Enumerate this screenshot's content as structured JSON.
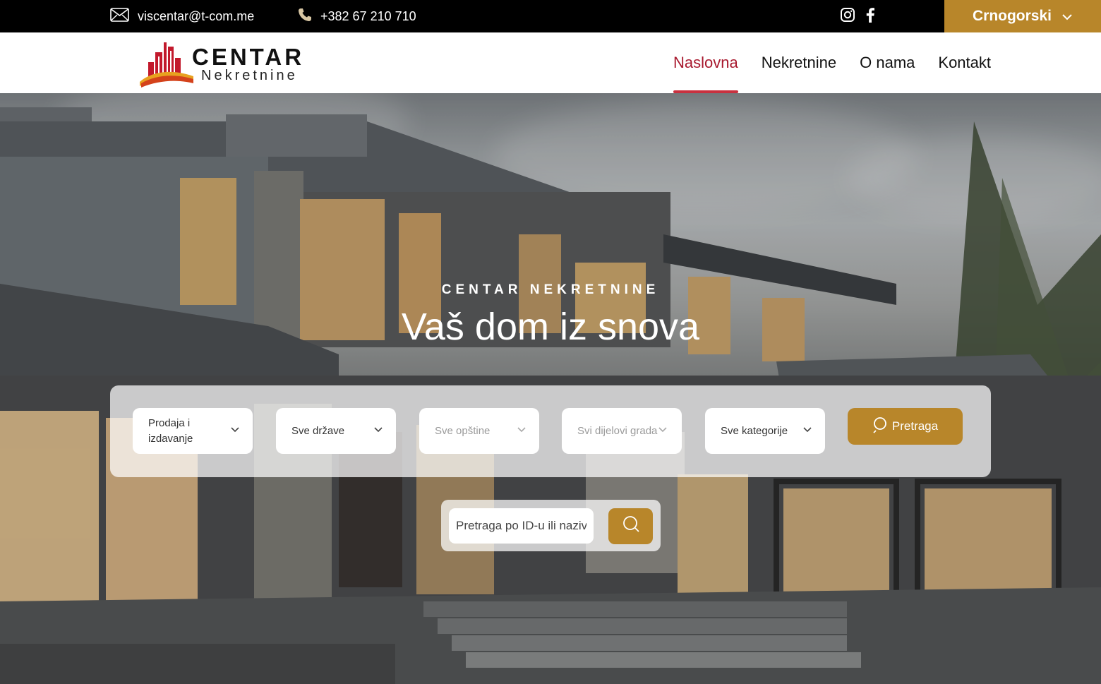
{
  "topbar": {
    "email": "viscentar@t-com.me",
    "phone": "+382 67 210 710",
    "social": [
      "instagram-icon",
      "facebook-icon"
    ],
    "language": "Crnogorski"
  },
  "header": {
    "logo_line1": "CENTAR",
    "logo_line2": "Nekretnine",
    "nav": [
      {
        "label": "Naslovna",
        "active": true
      },
      {
        "label": "Nekretnine",
        "active": false
      },
      {
        "label": "O nama",
        "active": false
      },
      {
        "label": "Kontakt",
        "active": false
      }
    ]
  },
  "hero": {
    "kicker": "CENTAR NEKRETNINE",
    "title": "Vaš dom iz snova"
  },
  "search": {
    "filters": [
      {
        "label": "Prodaja i izdavanje",
        "muted": false
      },
      {
        "label": "Sve države",
        "muted": false
      },
      {
        "label": "Sve opštine",
        "muted": true
      },
      {
        "label": "Svi dijelovi grada",
        "muted": true
      },
      {
        "label": "Sve kategorije",
        "muted": false
      }
    ],
    "button_label": "Pretraga",
    "id_placeholder": "Pretraga po ID-u ili nazivu"
  },
  "colors": {
    "accent_gold": "#b8862a",
    "nav_active": "#a8192e",
    "topbar_bg": "#000000"
  }
}
